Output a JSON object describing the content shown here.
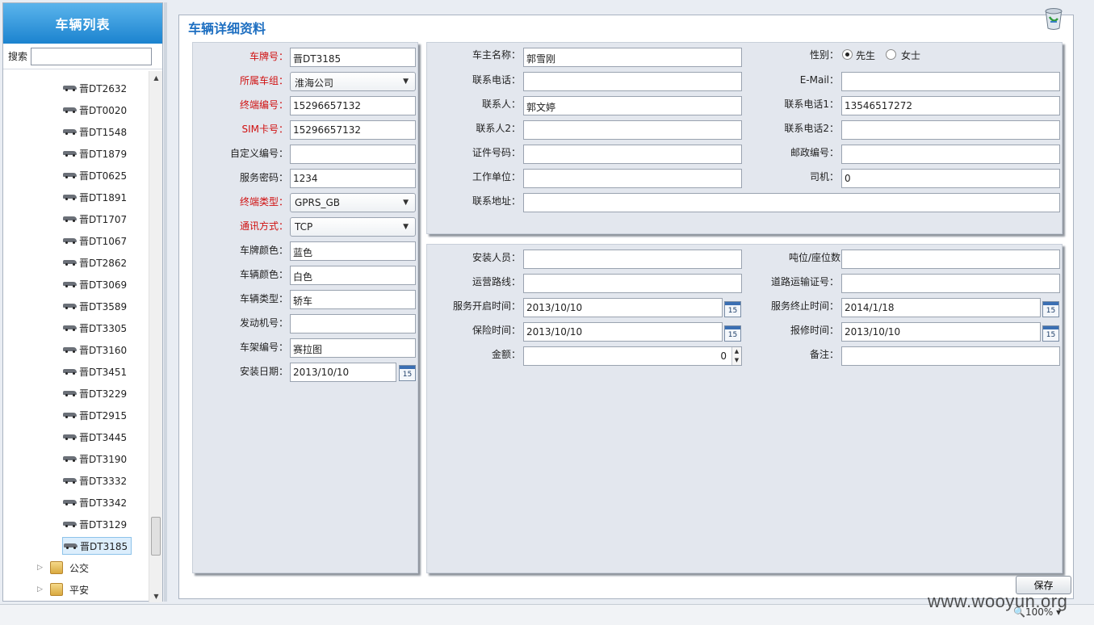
{
  "sidebar": {
    "title": "车辆列表",
    "search_label": "搜索",
    "search_value": "",
    "vehicles": [
      "晋DT2632",
      "晋DT0020",
      "晋DT1548",
      "晋DT1879",
      "晋DT0625",
      "晋DT1891",
      "晋DT1707",
      "晋DT1067",
      "晋DT2862",
      "晋DT3069",
      "晋DT3589",
      "晋DT3305",
      "晋DT3160",
      "晋DT3451",
      "晋DT3229",
      "晋DT2915",
      "晋DT3445",
      "晋DT3190",
      "晋DT3332",
      "晋DT3342",
      "晋DT3129",
      "晋DT3185"
    ],
    "selected_vehicle": "晋DT3185",
    "groups": [
      "公交",
      "平安"
    ]
  },
  "main": {
    "title": "车辆详细资料",
    "save_label": "保存"
  },
  "vehicle_form": {
    "plate_label": "车牌号：",
    "plate_value": "晋DT3185",
    "group_label": "所属车组：",
    "group_value": "淮海公司",
    "terminal_no_label": "终端编号：",
    "terminal_no_value": "15296657132",
    "sim_label": "SIM卡号：",
    "sim_value": "15296657132",
    "custom_no_label": "自定义编号：",
    "custom_no_value": "",
    "service_pwd_label": "服务密码：",
    "service_pwd_value": "1234",
    "terminal_type_label": "终端类型：",
    "terminal_type_value": "GPRS_GB",
    "comm_label": "通讯方式：",
    "comm_value": "TCP",
    "plate_color_label": "车牌颜色：",
    "plate_color_value": "蓝色",
    "body_color_label": "车辆颜色：",
    "body_color_value": "白色",
    "vehicle_type_label": "车辆类型：",
    "vehicle_type_value": "轿车",
    "engine_label": "发动机号：",
    "engine_value": "",
    "frame_label": "车架编号：",
    "frame_value": "赛拉图",
    "install_date_label": "安装日期：",
    "install_date_value": "2013/10/10"
  },
  "owner_form": {
    "owner_name_label": "车主名称：",
    "owner_name_value": "郭雪刚",
    "gender_label": "性别：",
    "gender_male": "先生",
    "gender_female": "女士",
    "gender_selected": "先生",
    "phone_label": "联系电话：",
    "phone_value": "",
    "email_label": "E-Mail：",
    "email_value": "",
    "contact_label": "联系人：",
    "contact_value": "郭文婷",
    "phone1_label": "联系电话1：",
    "phone1_value": "13546517272",
    "contact2_label": "联系人2：",
    "contact2_value": "",
    "phone2_label": "联系电话2：",
    "phone2_value": "",
    "id_label": "证件号码：",
    "id_value": "",
    "postal_label": "邮政编号：",
    "postal_value": "",
    "work_label": "工作单位：",
    "work_value": "",
    "driver_label": "司机：",
    "driver_value": "0",
    "address_label": "联系地址：",
    "address_value": ""
  },
  "install_form": {
    "installer_label": "安装人员：",
    "installer_value": "",
    "tonnage_label": "吨位/座位数",
    "tonnage_value": "",
    "route_label": "运营路线：",
    "route_value": "",
    "transport_cert_label": "道路运输证号：",
    "transport_cert_value": "",
    "service_start_label": "服务开启时间：",
    "service_start_value": "2013/10/10",
    "service_end_label": "服务终止时间：",
    "service_end_value": "2014/1/18",
    "insurance_label": "保险时间：",
    "insurance_value": "2013/10/10",
    "repair_label": "报修时间：",
    "repair_value": "2013/10/10",
    "amount_label": "金额：",
    "amount_value": "0",
    "remark_label": "备注：",
    "remark_value": ""
  },
  "icons": {
    "calendar": "calendar-icon",
    "trash": "trash-icon",
    "car": "car-icon",
    "folder": "folder-icon",
    "zoom": "zoom-icon"
  },
  "calendar_day": "15",
  "status": {
    "zoom": "100%"
  },
  "watermark": "www.wooyun.org",
  "colors": {
    "accent": "#1e6fc1",
    "required": "#d01010",
    "header": "#2b8fd8"
  }
}
